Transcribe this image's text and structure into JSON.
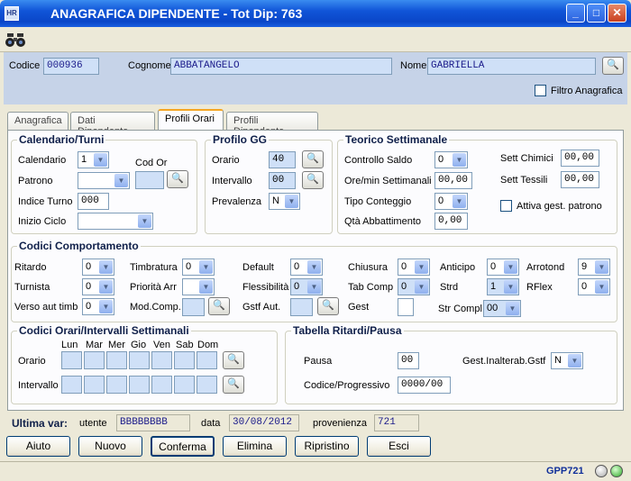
{
  "window": {
    "app_icon": "HR",
    "title": "ANAGRAFICA DIPENDENTE - Tot Dip: 763",
    "minimize_icon": "minimize-icon",
    "maximize_icon": "maximize-icon",
    "close_icon": "close-icon"
  },
  "toolbar": {
    "icon": "binoculars-icon"
  },
  "header": {
    "codice_label": "Codice",
    "codice_value": "000936",
    "cognome_label": "Cognome",
    "cognome_value": "ABBATANGELO",
    "nome_label": "Nome",
    "nome_value": "GABRIELLA",
    "filtro_label": "Filtro Anagrafica"
  },
  "tabs": [
    "Anagrafica",
    "Dati Dipendente",
    "Profili Orari",
    "Profili Dipendente"
  ],
  "calendario": {
    "title": "Calendario/Turni",
    "calendario_label": "Calendario",
    "calendario_value": "1",
    "cod_or_label": "Cod Or",
    "patrono_label": "Patrono",
    "patrono_value": "",
    "indice_label": "Indice Turno",
    "indice_value": "000",
    "inizio_label": "Inizio Ciclo",
    "inizio_value": ""
  },
  "profilo": {
    "title": "Profilo GG",
    "orario_label": "Orario",
    "orario_value": "40",
    "intervallo_label": "Intervallo",
    "intervallo_value": "00",
    "prevalenza_label": "Prevalenza",
    "prevalenza_value": "N"
  },
  "teorico": {
    "title": "Teorico Settimanale",
    "controllo_label": "Controllo Saldo",
    "controllo_value": "0",
    "ore_label": "Ore/min Settimanali",
    "ore_value": "00,00",
    "tipo_label": "Tipo Conteggio",
    "tipo_value": "0",
    "qta_label": "Qtà Abbattimento",
    "qta_value": "0,00",
    "chimici_label": "Sett Chimici",
    "chimici_value": "00,00",
    "tessili_label": "Sett Tessili",
    "tessili_value": "00,00",
    "attiva_label": "Attiva gest. patrono"
  },
  "comportamento": {
    "title": "Codici Comportamento",
    "ritardo_label": "Ritardo",
    "ritardo_value": "0",
    "turnista_label": "Turnista",
    "turnista_value": "0",
    "verso_label": "Verso aut timb",
    "verso_value": "0",
    "timbratura_label": "Timbratura",
    "timbratura_value": "0",
    "priorita_label": "Priorità Arr",
    "priorita_value": "",
    "modcomp_label": "Mod.Comp.",
    "default_label": "Default",
    "default_value": "0",
    "flessibilita_label": "Flessibilità",
    "flessibilita_value": "0",
    "gstf_label": "Gstf Aut.",
    "chiusura_label": "Chiusura",
    "chiusura_value": "0",
    "tabcomp_label": "Tab Comp",
    "tabcomp_value": "0",
    "gest_label": "Gest",
    "anticipo_label": "Anticipo",
    "anticipo_value": "0",
    "strd_label": "Strd",
    "strd_value": "1",
    "strcompl_label": "Str Compl",
    "strcompl_value": "00",
    "arrotond_label": "Arrotond",
    "arrotond_value": "9",
    "rflex_label": "RFlex",
    "rflex_value": "0"
  },
  "intervalli": {
    "title": "Codici Orari/Intervalli Settimanali",
    "days": [
      "Lun",
      "Mar",
      "Mer",
      "Gio",
      "Ven",
      "Sab",
      "Dom"
    ],
    "orario_label": "Orario",
    "intervallo_label": "Intervallo"
  },
  "ritardi": {
    "title": "Tabella Ritardi/Pausa",
    "pausa_label": "Pausa",
    "pausa_value": "00",
    "gest_label": "Gest.Inalterab.Gstf",
    "gest_value": "N",
    "codice_label": "Codice/Progressivo",
    "codice_value": "0000/00"
  },
  "footer": {
    "ultima_label": "Ultima var:",
    "utente_label": "utente",
    "utente_value": "BBBBBBBB",
    "data_label": "data",
    "data_value": "30/08/2012",
    "provenienza_label": "provenienza",
    "provenienza_value": "721"
  },
  "buttons": {
    "aiuto": "Aiuto",
    "nuovo": "Nuovo",
    "conferma": "Conferma",
    "elimina": "Elimina",
    "ripristino": "Ripristino",
    "esci": "Esci"
  },
  "status": {
    "code": "GPP721"
  }
}
